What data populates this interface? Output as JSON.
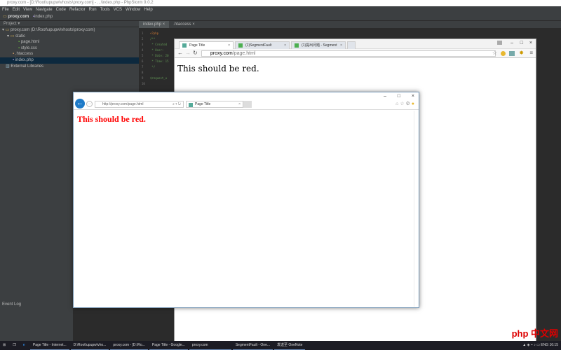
{
  "ide": {
    "title": "proxy.com - [D:\\Root\\upupw\\vhosts\\proxy.com] - ...\\index.php - PhpStorm 9.0.2",
    "menu": [
      "File",
      "Edit",
      "View",
      "Navigate",
      "Code",
      "Refactor",
      "Run",
      "Tools",
      "VCS",
      "Window",
      "Help"
    ],
    "breadcrumb": [
      "proxy.com",
      "index.php"
    ],
    "project_label": "Project",
    "tree": [
      {
        "label": "proxy.com (D:\\Root\\upupw\\vhosts\\proxy.com)",
        "indent": 0
      },
      {
        "label": "static",
        "indent": 1
      },
      {
        "label": "page.html",
        "indent": 2
      },
      {
        "label": "style.css",
        "indent": 2
      },
      {
        "label": ".htaccess",
        "indent": 1
      },
      {
        "label": "index.php",
        "indent": 1
      },
      {
        "label": "External Libraries",
        "indent": 0
      }
    ],
    "tabs": [
      "index.php",
      ".htaccess"
    ],
    "code": [
      [
        "1",
        "<?php"
      ],
      [
        "2",
        "/**"
      ],
      [
        "3",
        " * Created"
      ],
      [
        "4",
        " * User: "
      ],
      [
        "5",
        " * Date: 20"
      ],
      [
        "6",
        " * Time: 15"
      ],
      [
        "7",
        " */"
      ],
      [
        "8",
        ""
      ],
      [
        "9",
        "$request_u"
      ],
      [
        "10",
        ""
      ]
    ],
    "event_log": "Event Log"
  },
  "chrome": {
    "tabs": [
      "Page Title",
      "(1)SegmentFault",
      "(1)提出问题 - Segment"
    ],
    "url_host": "proxy.com",
    "url_path": "/page.html",
    "body_text": "This should be red."
  },
  "ie": {
    "url": "http://proxy.com/page.html",
    "tab": "Page Title",
    "body_text": "This should be red."
  },
  "taskbar": {
    "items": [
      "Page Title - Internet...",
      "D:\\Root\\upupw\\vho...",
      "proxy.com - [D:\\Ro...",
      "Page Title - Google...",
      "proxy.com",
      "SegmentFault - One...",
      "发送至 OneNote"
    ],
    "lang": "ENG",
    "time": "16:15"
  },
  "watermark": "php 中文网"
}
